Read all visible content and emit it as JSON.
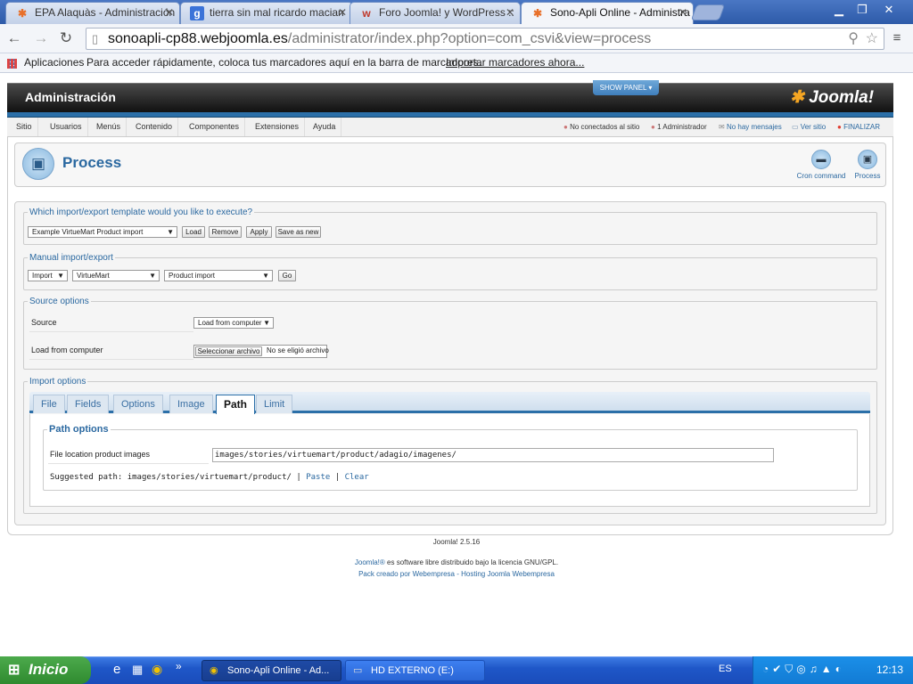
{
  "browser": {
    "tabs": [
      {
        "label": "EPA Alaquàs - Administración",
        "favicon": "joomla-icon",
        "active": false
      },
      {
        "label": "tierra sin mal ricardo macian",
        "favicon": "google-icon",
        "active": false
      },
      {
        "label": "Foro Joomla! y WordPress ::",
        "favicon": "forum-icon",
        "active": false
      },
      {
        "label": "Sono-Apli Online - Administra",
        "favicon": "joomla-icon",
        "active": true
      }
    ],
    "url_host": "sonoapli-cp88.webjoomla.es",
    "url_path": "/administrator/index.php?option=com_csvi&view=process",
    "bookmarks": {
      "apps": "Aplicaciones",
      "hint": "Para acceder rápidamente, coloca tus marcadores aquí en la barra de marcadores.",
      "import_link": "Importar marcadores ahora..."
    }
  },
  "admin": {
    "header_title": "Administración",
    "show_panel": "SHOW PANEL",
    "logo": "Joomla!",
    "menu": [
      "Sitio",
      "Usuarios",
      "Menús",
      "Contenido",
      "Componentes",
      "Extensiones",
      "Ayuda"
    ],
    "status": {
      "visitors": "No conectados al sitio",
      "admins": "1 Administrador",
      "messages": "No hay mensajes",
      "view_site": "Ver sitio",
      "logout": "FINALIZAR"
    }
  },
  "page": {
    "title": "Process",
    "toolbar": {
      "cron": "Cron command",
      "process": "Process"
    }
  },
  "template_section": {
    "legend": "Which import/export template would you like to execute?",
    "selected": "Example VirtueMart Product import",
    "buttons": {
      "load": "Load",
      "remove": "Remove",
      "apply": "Apply",
      "save_as_new": "Save as new"
    }
  },
  "manual_section": {
    "legend": "Manual import/export",
    "action": "Import",
    "component": "VirtueMart",
    "operation": "Product import",
    "go": "Go"
  },
  "source_section": {
    "legend": "Source options",
    "source_label": "Source",
    "source_value": "Load from computer",
    "file_label": "Load from computer",
    "file_button": "Seleccionar archivo",
    "file_status": "No se eligió archivo"
  },
  "import_options": {
    "legend": "Import options",
    "tabs": [
      "File",
      "Fields",
      "Options",
      "Image",
      "Path",
      "Limit"
    ],
    "active_tab": "Path",
    "path_legend": "Path options",
    "file_location_label": "File location product images",
    "file_location_value": "images/stories/virtuemart/product/adagio/imagenes/",
    "suggested_label": "Suggested path: images/stories/virtuemart/product/",
    "paste": "Paste",
    "clear": "Clear"
  },
  "footer": {
    "version": "Joomla! 2.5.16",
    "license_brand": "Joomla!®",
    "license_text": " es software libre distribuido bajo la licencia GNU/GPL.",
    "credits": "Pack creado por Webempresa - Hosting Joomla Webempresa"
  },
  "taskbar": {
    "start": "Inicio",
    "tasks": [
      "Sono-Apli Online - Ad...",
      "HD EXTERNO (E:)"
    ],
    "lang": "ES",
    "clock": "12:13"
  }
}
